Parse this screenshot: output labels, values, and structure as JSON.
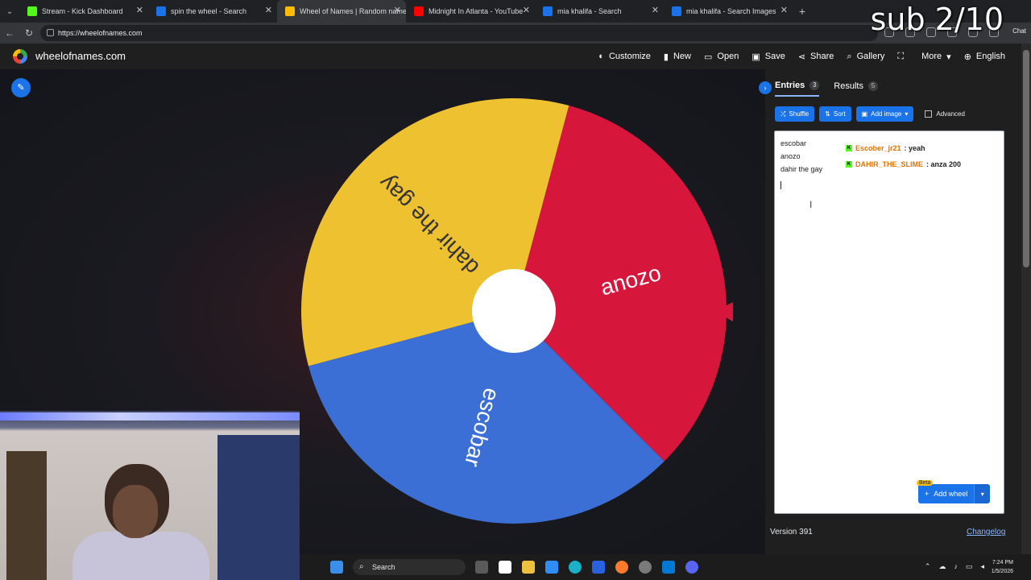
{
  "overlay": {
    "text": "sub 2/10"
  },
  "browser": {
    "tabs": [
      {
        "label": "Stream - Kick Dashboard",
        "color": "#53fc18"
      },
      {
        "label": "spin the wheel - Search",
        "color": "#1a73e8"
      },
      {
        "label": "Wheel of Names | Random name p",
        "color": "#fbbc05",
        "active": true
      },
      {
        "label": "Midnight In Atlanta - YouTube",
        "color": "#ff0000"
      },
      {
        "label": "mia khalifa - Search",
        "color": "#1a73e8"
      },
      {
        "label": "mia khalifa - Search Images",
        "color": "#1a73e8"
      }
    ],
    "url": "https://wheelofnames.com",
    "chat_label": "Chat"
  },
  "app": {
    "brand": "wheelofnames.com",
    "menu": [
      {
        "icon": "palette-icon",
        "glyph": "◐",
        "label": "Customize"
      },
      {
        "icon": "file-icon",
        "glyph": "▮",
        "label": "New"
      },
      {
        "icon": "folder-icon",
        "glyph": "▭",
        "label": "Open"
      },
      {
        "icon": "save-icon",
        "glyph": "▣",
        "label": "Save"
      },
      {
        "icon": "share-icon",
        "glyph": "⋖",
        "label": "Share"
      },
      {
        "icon": "search-icon",
        "glyph": "⌕",
        "label": "Gallery"
      },
      {
        "icon": "fullscreen-icon",
        "glyph": "⛶",
        "label": ""
      },
      {
        "icon": "chevron-down-icon",
        "glyph": "▾",
        "label": "More"
      },
      {
        "icon": "globe-icon",
        "glyph": "⊕",
        "label": "English"
      }
    ]
  },
  "wheel": {
    "segments": [
      {
        "label": "anozo",
        "color": "#d6163a"
      },
      {
        "label": "escobar",
        "color": "#3b6fd6"
      },
      {
        "label": "dahir the gay",
        "color": "#eec131"
      }
    ],
    "pointer_color": "#d6163a"
  },
  "panel": {
    "tabs": [
      {
        "label": "Entries",
        "count": "3"
      },
      {
        "label": "Results",
        "count": "5"
      }
    ],
    "buttons": {
      "shuffle": "Shuffle",
      "sort": "Sort",
      "add_image": "Add image",
      "advanced": "Advanced"
    },
    "entries": [
      "escobar",
      "anozo",
      "dahir the gay"
    ],
    "chat": [
      {
        "user": "Escober_jr21",
        "message": ": yeah"
      },
      {
        "user": "DAHIR_THE_SLIME",
        "message": ": anza 200"
      }
    ],
    "beta": "Beta",
    "add_wheel": "Add wheel",
    "version": "Version 391",
    "changelog": "Changelog"
  },
  "taskbar": {
    "search": "Search",
    "time": "7:24 PM",
    "date": "1/5/2026"
  }
}
